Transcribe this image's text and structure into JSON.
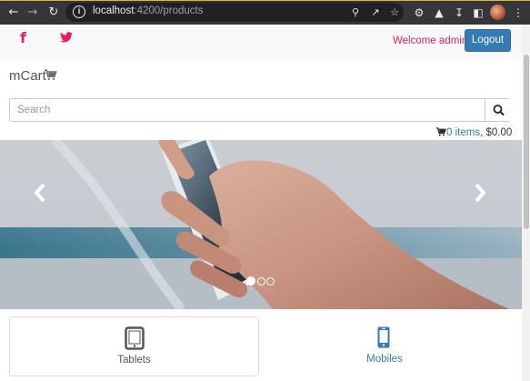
{
  "browser": {
    "url_host": "localhost",
    "url_path": ":4200/products",
    "icons": [
      "back-icon",
      "forward-icon",
      "reload-icon",
      "info-icon",
      "zoom-icon",
      "share-icon",
      "star-icon",
      "extensions-icon",
      "flask-icon",
      "download-icon",
      "sidebar-icon",
      "menu-icon"
    ]
  },
  "header": {
    "welcome_text": "Welcome admin",
    "logout_label": "Logout",
    "brand_color": "#e91e63",
    "button_color": "#337ab7"
  },
  "brand": {
    "name": "mCart"
  },
  "search": {
    "placeholder": "Search"
  },
  "cart": {
    "items_text": "0 items",
    "separator": ",",
    "total": "$0.00"
  },
  "carousel": {
    "slide_count": 3,
    "active_index": 0
  },
  "categories": [
    {
      "label": "Tablets",
      "icon": "tablet-icon",
      "active": false
    },
    {
      "label": "Mobiles",
      "icon": "mobile-icon",
      "active": true
    }
  ]
}
